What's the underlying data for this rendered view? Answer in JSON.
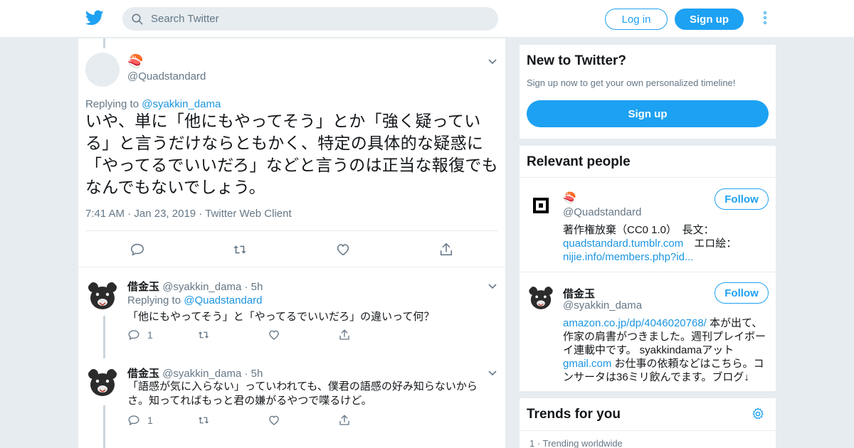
{
  "header": {
    "search_placeholder": "Search Twitter",
    "login_label": "Log in",
    "signup_label": "Sign up"
  },
  "main_tweet": {
    "author_emoji": "🍣",
    "handle": "@Quadstandard",
    "replying_prefix": "Replying to",
    "replying_handle": "@syakkin_dama",
    "text": "いや、単に「他にもやってそう」とか「強く疑っている」と言うだけならともかく、特定の具体的な疑惑に「やってるでいいだろ」などと言うのは正当な報復でもなんでもないでしょう。",
    "time": "7:41 AM",
    "date": "Jan 23, 2019",
    "client": "Twitter Web Client"
  },
  "replies": [
    {
      "name": "借金玉",
      "handle": "@syakkin_dama",
      "time": "5h",
      "replying_prefix": "Replying to",
      "replying_handle": "@Quadstandard",
      "text": "「他にもやってそう」と「やってるでいいだろ」の違いって何？",
      "reply_count": "1"
    },
    {
      "name": "借金玉",
      "handle": "@syakkin_dama",
      "time": "5h",
      "text": "「語感が気に入らない」っていわれても、僕君の語感の好み知らないからさ。知ってればもっと君の嫌がるやつで喋るけど。",
      "reply_count": "1"
    }
  ],
  "sidebar": {
    "new_to_twitter": {
      "title": "New to Twitter?",
      "subtitle": "Sign up now to get your own personalized timeline!",
      "signup_label": "Sign up"
    },
    "relevant_people": {
      "title": "Relevant people",
      "people": [
        {
          "name": "🍣",
          "handle": "@Quadstandard",
          "follow_label": "Follow",
          "bio_text_1": "著作権放棄（CC0 1.0）　長文：",
          "bio_link_1": "quadstandard.tumblr.com",
          "bio_text_2": "　エロ絵：",
          "bio_link_2": "nijie.info/members.php?id..."
        },
        {
          "name": "借金玉",
          "handle": "@syakkin_dama",
          "follow_label": "Follow",
          "bio_link_1": "amazon.co.jp/dp/4046020768/",
          "bio_text_1": " 本が出て、作家の肩書がつきました。週刊プレイボーイ連載中です。 syakkindamaアット",
          "bio_link_2": "gmail.com",
          "bio_text_2": " お仕事の依頼などはこちら。コンサータは36ミリ飲んでます。ブログ↓"
        }
      ]
    },
    "trends": {
      "title": "Trends for you",
      "first_item": "1 · Trending worldwide"
    }
  },
  "colors": {
    "accent": "#1da1f2",
    "link": "#1b95e0",
    "muted": "#657786",
    "background": "#e6ecf0"
  }
}
